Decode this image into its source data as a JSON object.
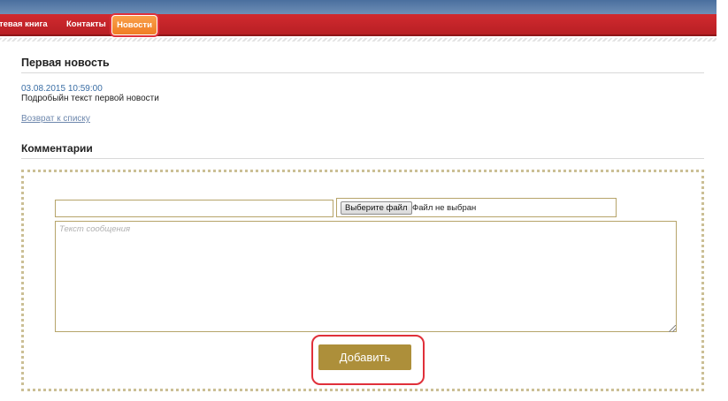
{
  "nav": {
    "items": [
      {
        "label": "тевая книга"
      },
      {
        "label": "Контакты"
      },
      {
        "label": "Новости",
        "active": true
      }
    ]
  },
  "news": {
    "title": "Первая новость",
    "date": "03.08.2015 10:59:00",
    "text": "Подробыйн текст первой новости",
    "back_link": "Возврат к списку"
  },
  "comments": {
    "title": "Комментарии",
    "name_value": "",
    "file_button_label": "Выберите файл",
    "file_status": "Файл не выбран",
    "message_placeholder": "Текст сообщения",
    "submit_label": "Добавить"
  },
  "colors": {
    "nav_bar": "#c4242a",
    "top_stripe": "#5b7fab",
    "active_tab": "#f28a30",
    "link": "#3a6ea5",
    "submit_button": "#ad8f3a",
    "field_border": "#b6a46a",
    "highlight": "#e0303a"
  }
}
